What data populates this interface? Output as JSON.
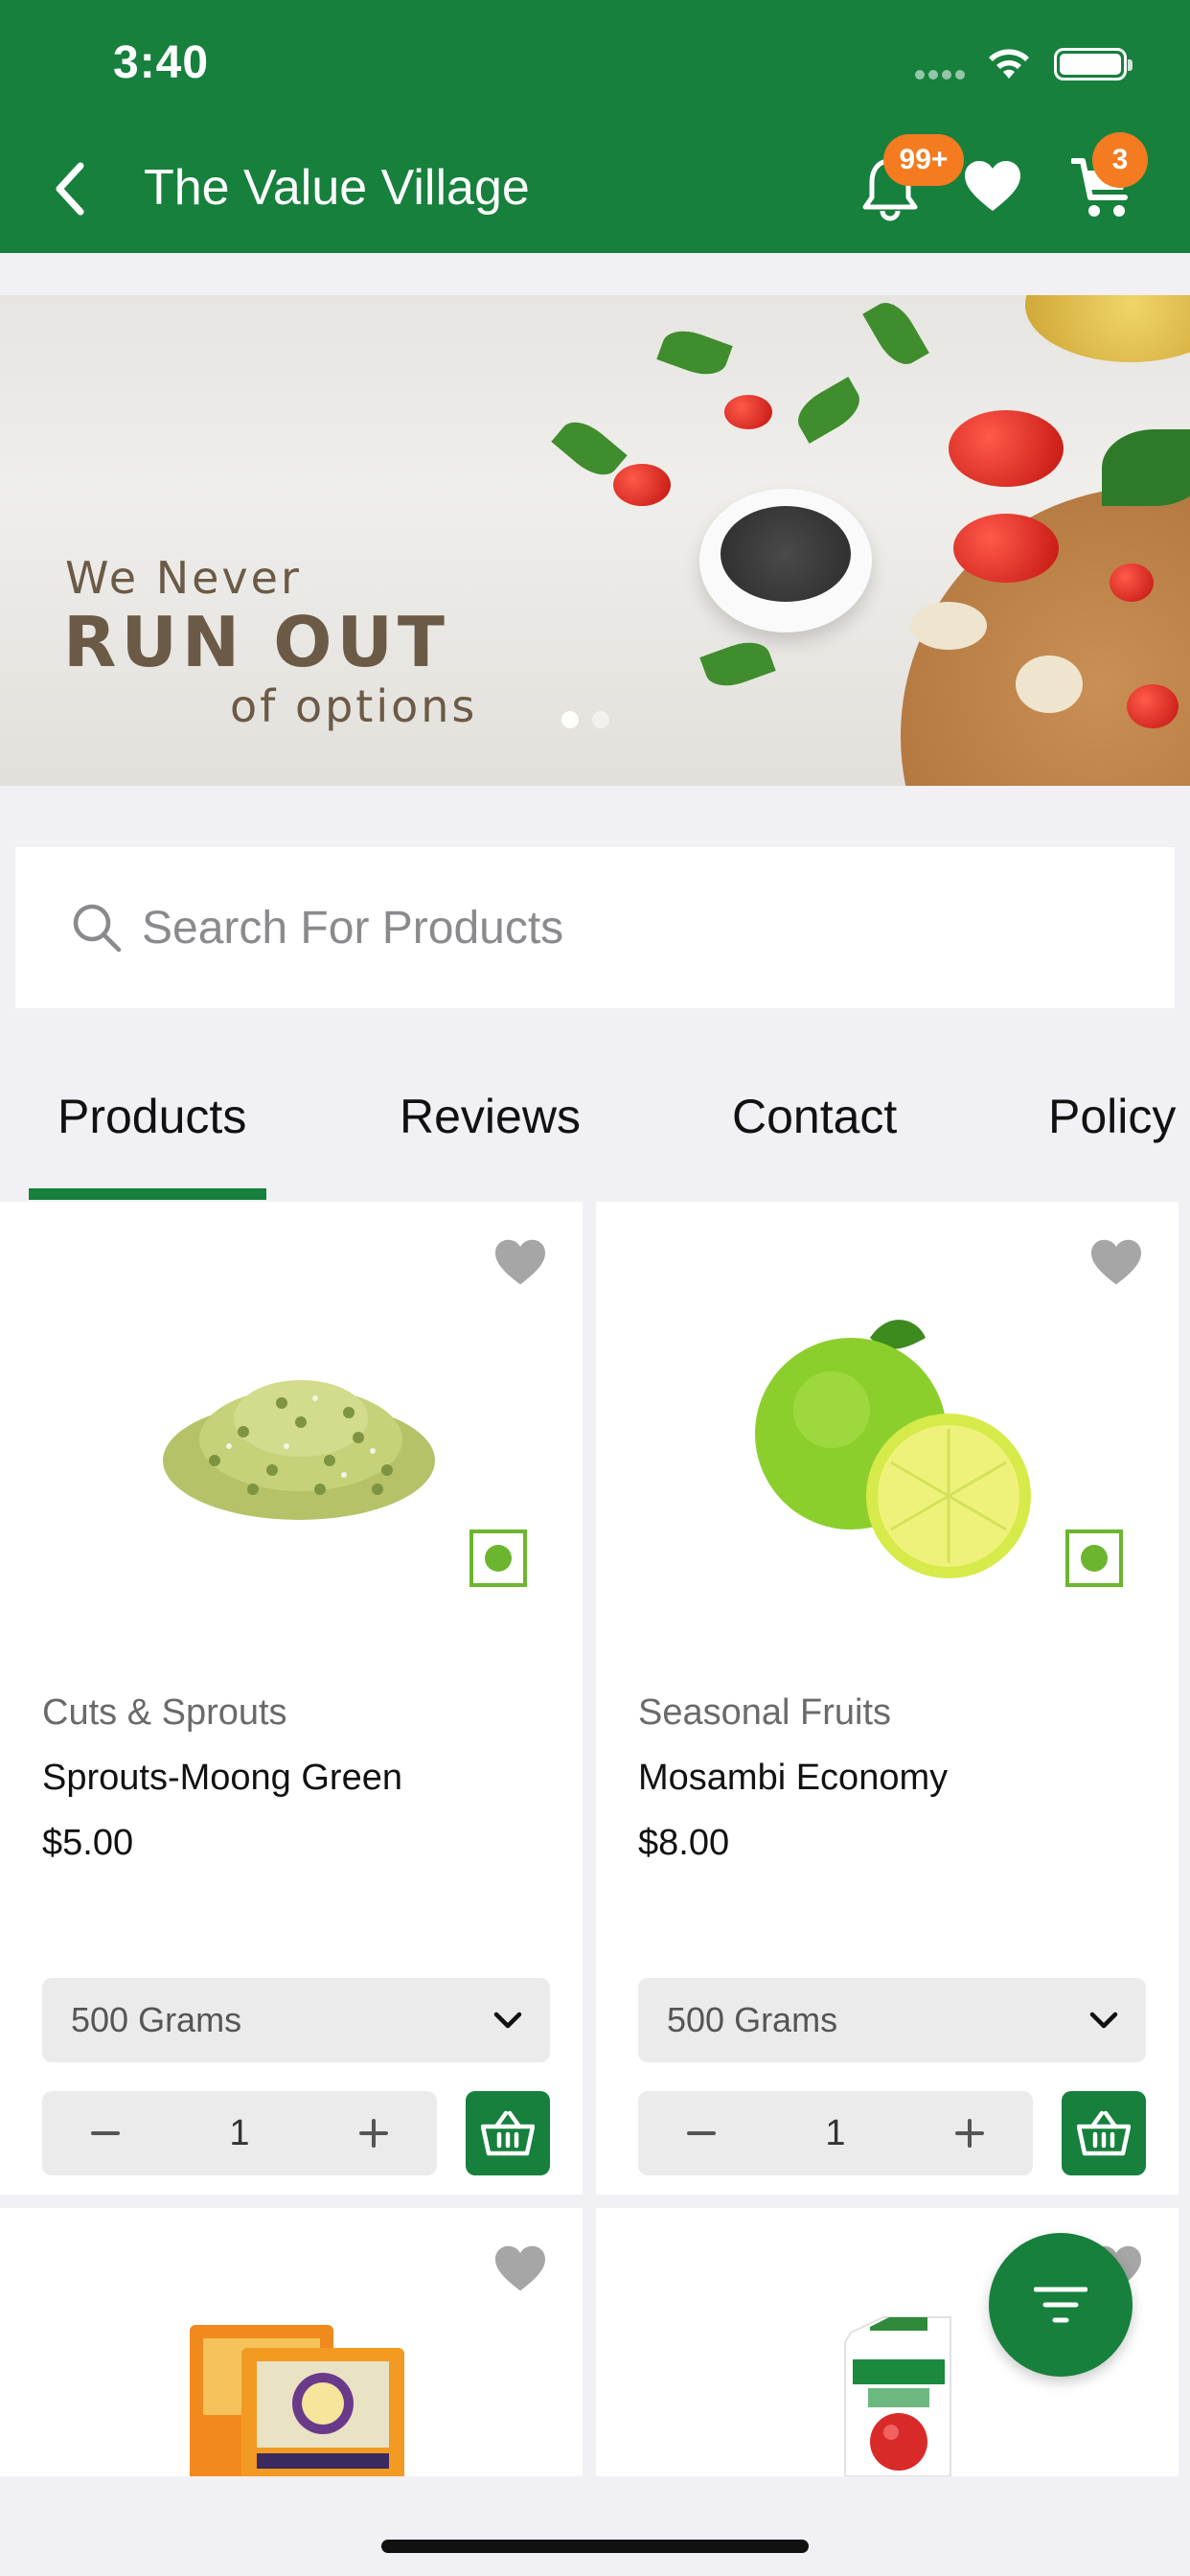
{
  "status_bar": {
    "time": "3:40"
  },
  "header": {
    "title": "The Value Village",
    "notifications_badge": "99+",
    "cart_badge": "3",
    "bg_color": "#16803c"
  },
  "banner": {
    "line1": "We Never",
    "line2": "RUN OUT",
    "line3": "of options"
  },
  "search": {
    "placeholder": "Search For Products"
  },
  "tabs": [
    {
      "label": "Products",
      "active": true
    },
    {
      "label": "Reviews"
    },
    {
      "label": "Contact"
    },
    {
      "label": "Policy"
    }
  ],
  "products": [
    {
      "category": "Cuts & Sprouts",
      "name": "Sprouts-Moong Green",
      "price": "$5.00",
      "size": "500 Grams",
      "qty": "1"
    },
    {
      "category": "Seasonal Fruits",
      "name": "Mosambi Economy",
      "price": "$8.00",
      "size": "500 Grams",
      "qty": "1"
    }
  ],
  "icons": {
    "back": "chevron-left-icon",
    "bell": "bell-icon",
    "wishlist": "heart-icon",
    "cart": "cart-icon",
    "search": "search-icon",
    "filter": "filter-icon",
    "basket": "basket-icon"
  },
  "colors": {
    "accent": "#16803c",
    "badge": "#f47b20",
    "veg": "#6cb52f"
  }
}
